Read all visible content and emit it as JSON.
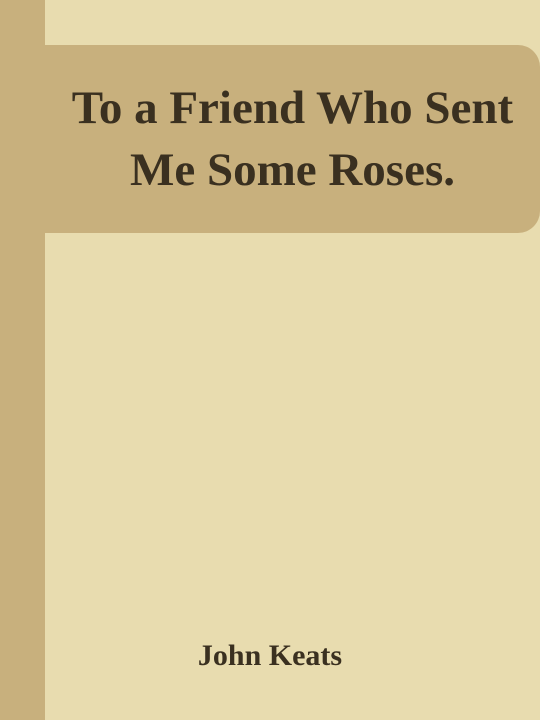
{
  "cover": {
    "title": "To a Friend Who Sent Me Some Roses.",
    "author": "John Keats"
  },
  "colors": {
    "background": "#e8dcaf",
    "band": "#c8b07d",
    "text": "#3a3020"
  }
}
